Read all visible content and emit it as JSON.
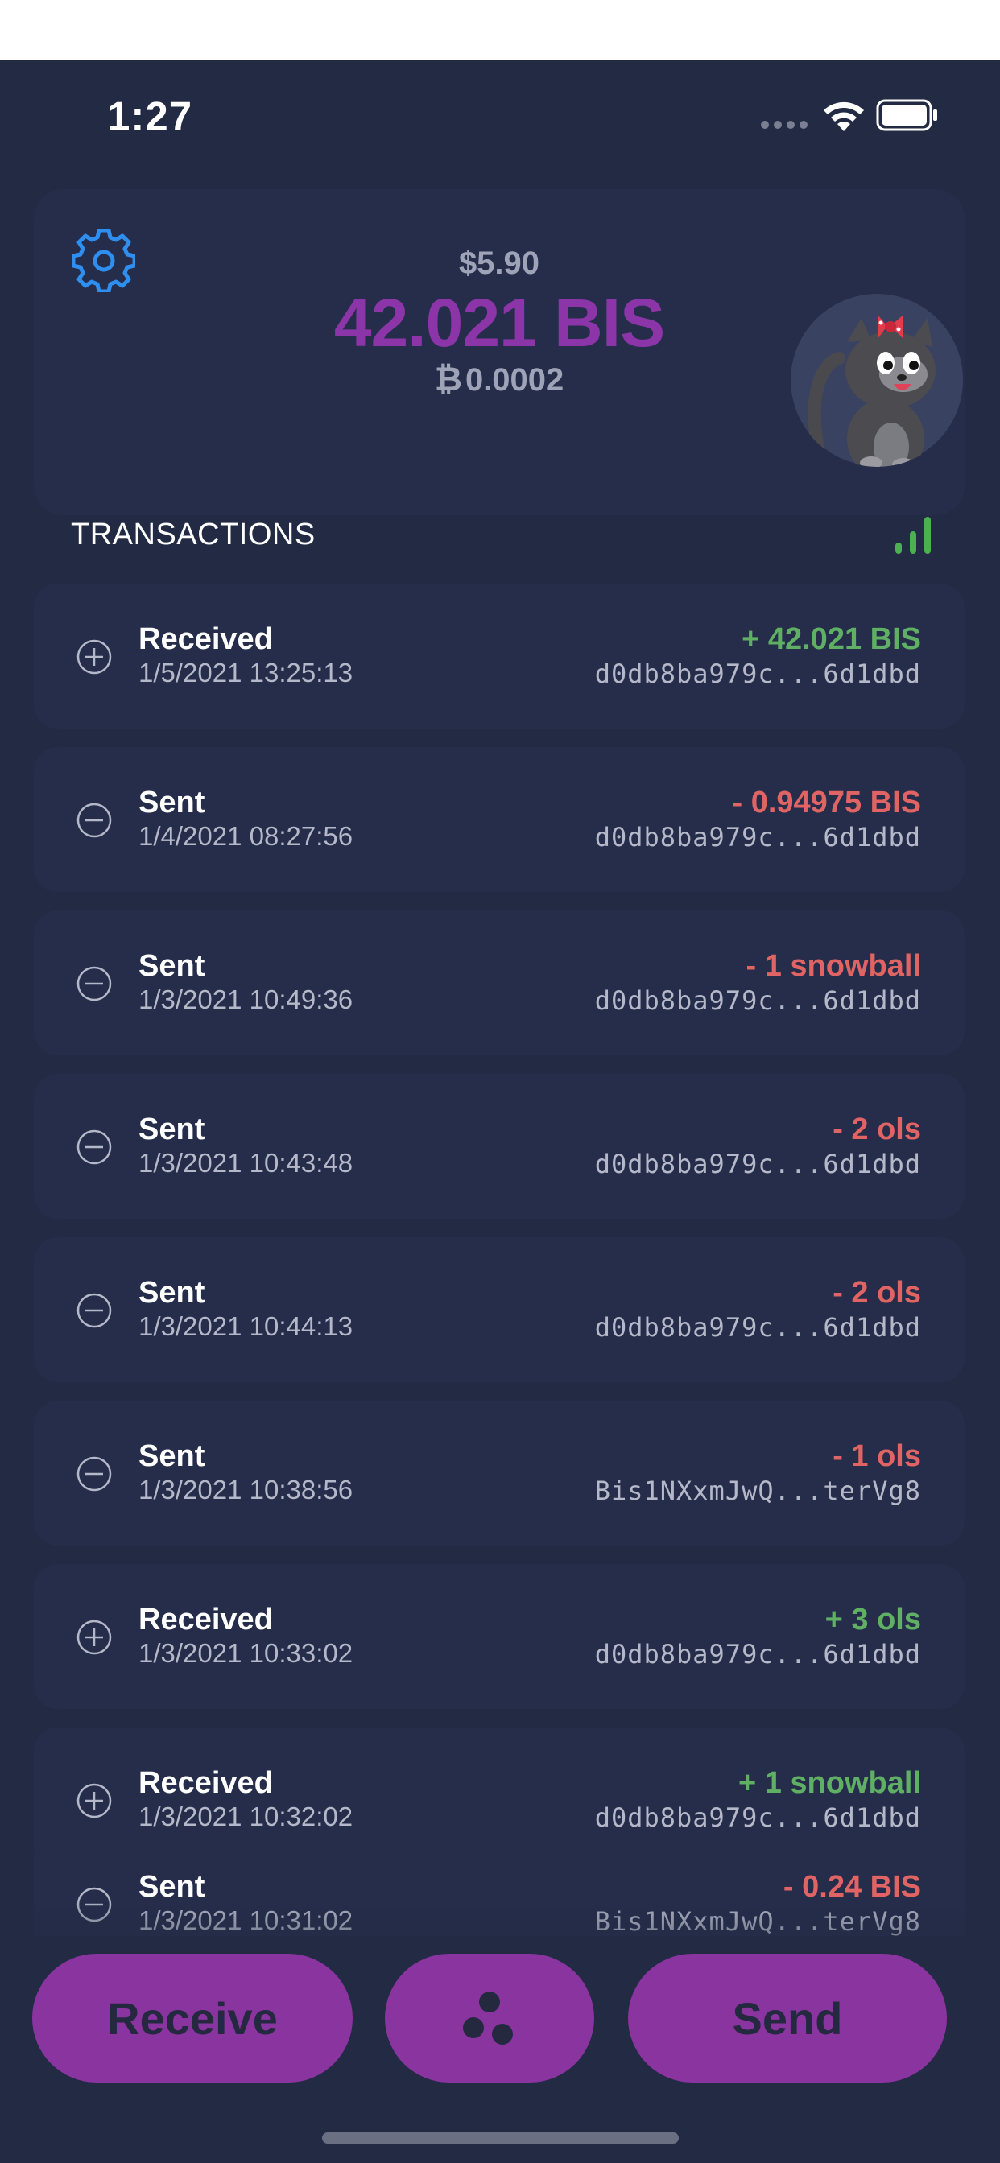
{
  "status_bar": {
    "time": "1:27"
  },
  "balance": {
    "fiat": "$5.90",
    "bis": "42.021 BIS",
    "btc_symbol": "₿",
    "btc": "0.0002"
  },
  "transactions": {
    "header": "TRANSACTIONS",
    "items": [
      {
        "type": "Received",
        "date": "1/5/2021 13:25:13",
        "amount": "+ 42.021 BIS",
        "address": "d0db8ba979c...6d1dbd",
        "direction": "in"
      },
      {
        "type": "Sent",
        "date": "1/4/2021 08:27:56",
        "amount": "- 0.94975 BIS",
        "address": "d0db8ba979c...6d1dbd",
        "direction": "out"
      },
      {
        "type": "Sent",
        "date": "1/3/2021 10:49:36",
        "amount": "- 1 snowball",
        "address": "d0db8ba979c...6d1dbd",
        "direction": "out"
      },
      {
        "type": "Sent",
        "date": "1/3/2021 10:43:48",
        "amount": "- 2 ols",
        "address": "d0db8ba979c...6d1dbd",
        "direction": "out"
      },
      {
        "type": "Sent",
        "date": "1/3/2021 10:44:13",
        "amount": "- 2 ols",
        "address": "d0db8ba979c...6d1dbd",
        "direction": "out"
      },
      {
        "type": "Sent",
        "date": "1/3/2021 10:38:56",
        "amount": "- 1 ols",
        "address": "Bis1NXxmJwQ...terVg8",
        "direction": "out"
      },
      {
        "type": "Received",
        "date": "1/3/2021 10:33:02",
        "amount": "+ 3 ols",
        "address": "d0db8ba979c...6d1dbd",
        "direction": "in"
      },
      {
        "type": "Received",
        "date": "1/3/2021 10:32:02",
        "amount": "+ 1 snowball",
        "address": "d0db8ba979c...6d1dbd",
        "direction": "in"
      },
      {
        "type": "Sent",
        "date": "1/3/2021 10:31:02",
        "amount": "- 0.24 BIS",
        "address": "Bis1NXxmJwQ...terVg8",
        "direction": "out"
      }
    ]
  },
  "actions": {
    "receive_label": "Receive",
    "send_label": "Send",
    "center_icon": "dots-icon"
  },
  "colors": {
    "background": "#232a44",
    "card": "#252d4a",
    "accent": "#8c35a8",
    "positive": "#5fb065",
    "negative": "#e06464",
    "gear": "#2e8ff0"
  }
}
